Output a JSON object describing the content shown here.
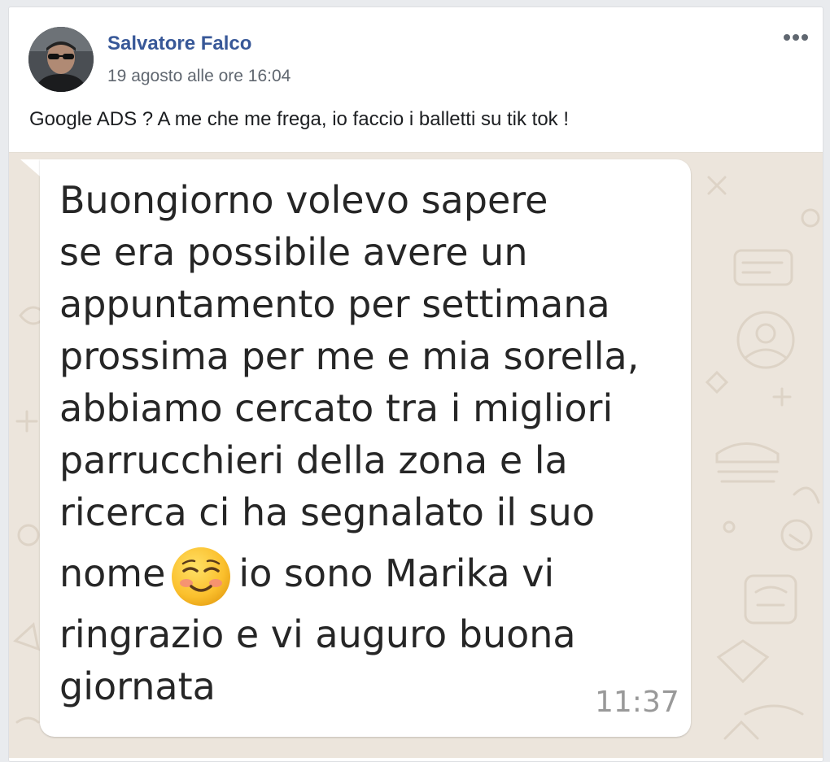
{
  "post": {
    "author": "Salvatore Falco",
    "timestamp": "19 agosto alle ore 16:04",
    "text": "Google ADS ? A me che me frega, io faccio i balletti su tik tok !",
    "more_icon": "ellipsis-icon",
    "avatar_icon": "profile-photo"
  },
  "message": {
    "lines": [
      "Buongiorno volevo sapere",
      "se era possibile avere un",
      "appuntamento per settimana",
      "prossima per me e mia sorella,",
      "abbiamo cercato tra i migliori",
      "parrucchieri della zona e la",
      "ricerca ci ha segnalato il suo"
    ],
    "emoji_line_before": "nome",
    "emoji_icon": "smiling-face-emoji",
    "emoji_line_after": "io sono Marika vi",
    "end_lines": [
      "ringrazio e vi auguro buona",
      "giornata"
    ],
    "time": "11:37"
  },
  "colors": {
    "author": "#385898",
    "wallpaper": "#ece5dc",
    "bubble": "#ffffff"
  }
}
